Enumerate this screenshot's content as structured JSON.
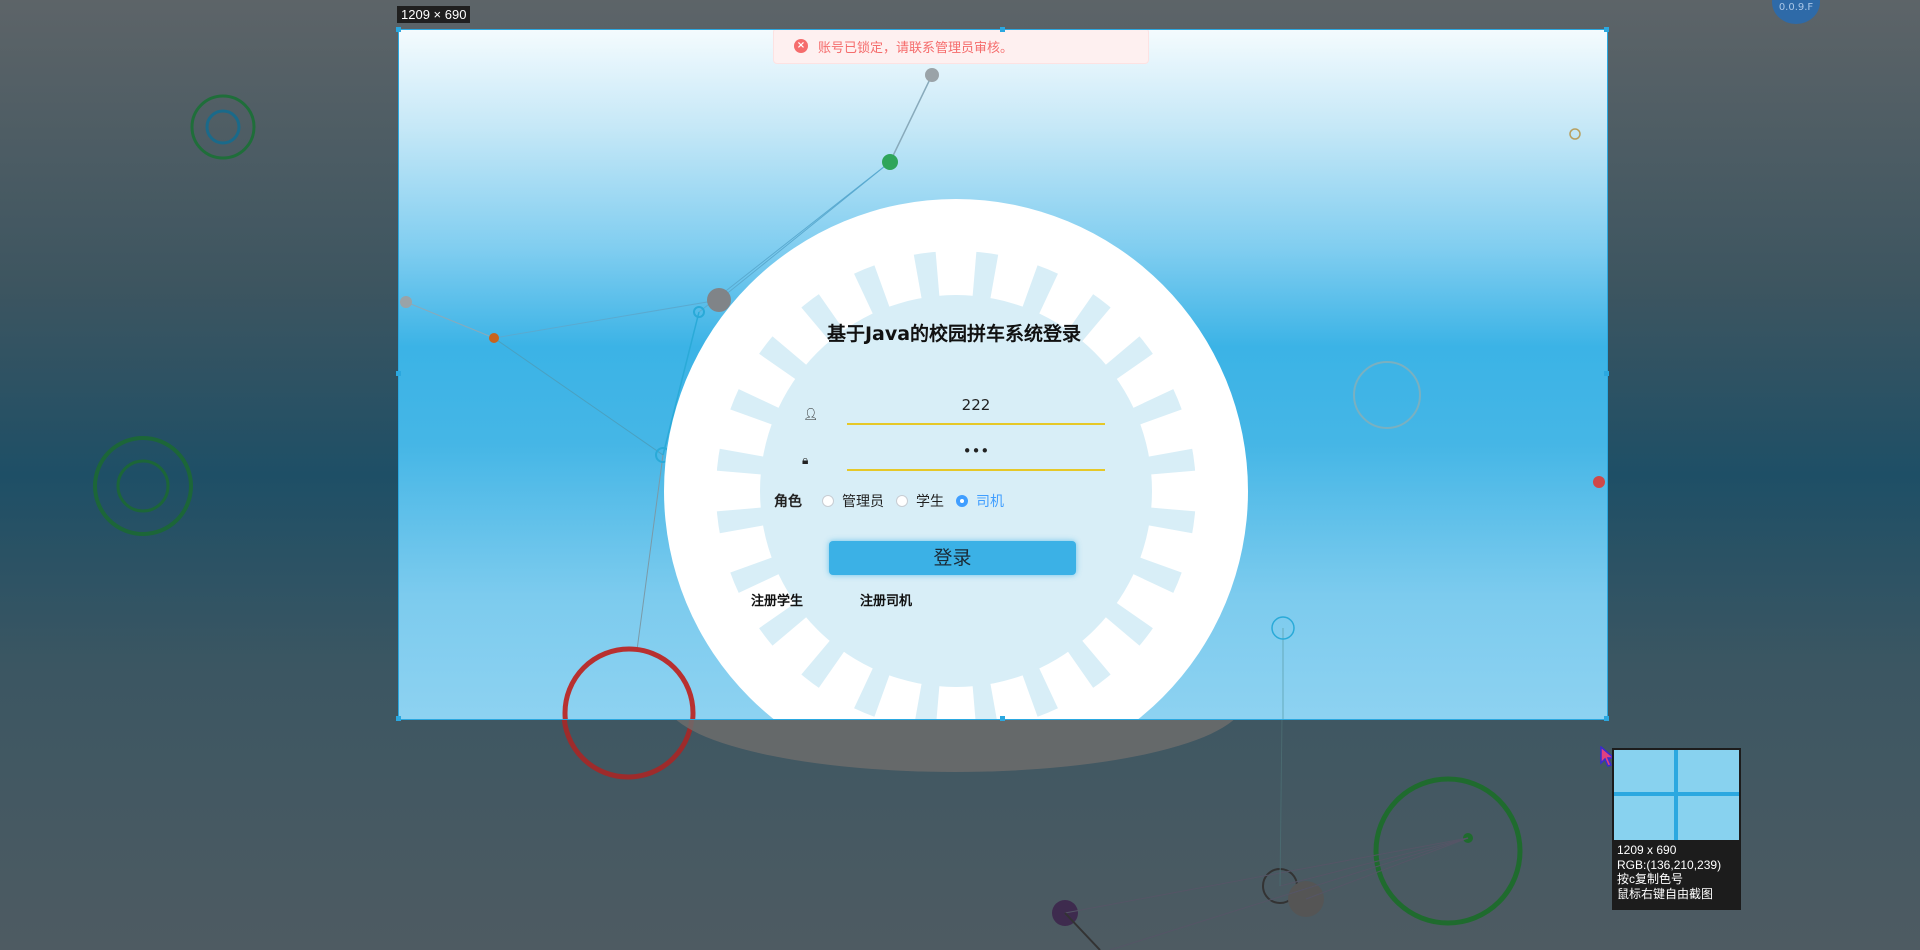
{
  "screenshot_tool": {
    "size_label": "1209 × 690",
    "magnifier": {
      "size": "1209 x 690",
      "rgb": "RGB:(136,210,239)",
      "hint_copy": "按c复制色号",
      "hint_right_click": "鼠标右键自由截图"
    },
    "corner_badge": "0.0.9.F"
  },
  "alert": {
    "message": "账号已锁定，请联系管理员审核。",
    "icon": "error-circle-icon",
    "color": "#f56c6c"
  },
  "login": {
    "title": "基于Java的校园拼车系统登录",
    "username_value": "222",
    "password_value": "•••",
    "role_label": "角色",
    "roles": [
      {
        "label": "管理员",
        "checked": false
      },
      {
        "label": "学生",
        "checked": false
      },
      {
        "label": "司机",
        "checked": true
      }
    ],
    "login_button": "登录",
    "register_student": "注册学生",
    "register_driver": "注册司机"
  },
  "colors": {
    "accent": "#409eff",
    "button": "#3bb1e6",
    "input_underline": "#e6c828"
  }
}
